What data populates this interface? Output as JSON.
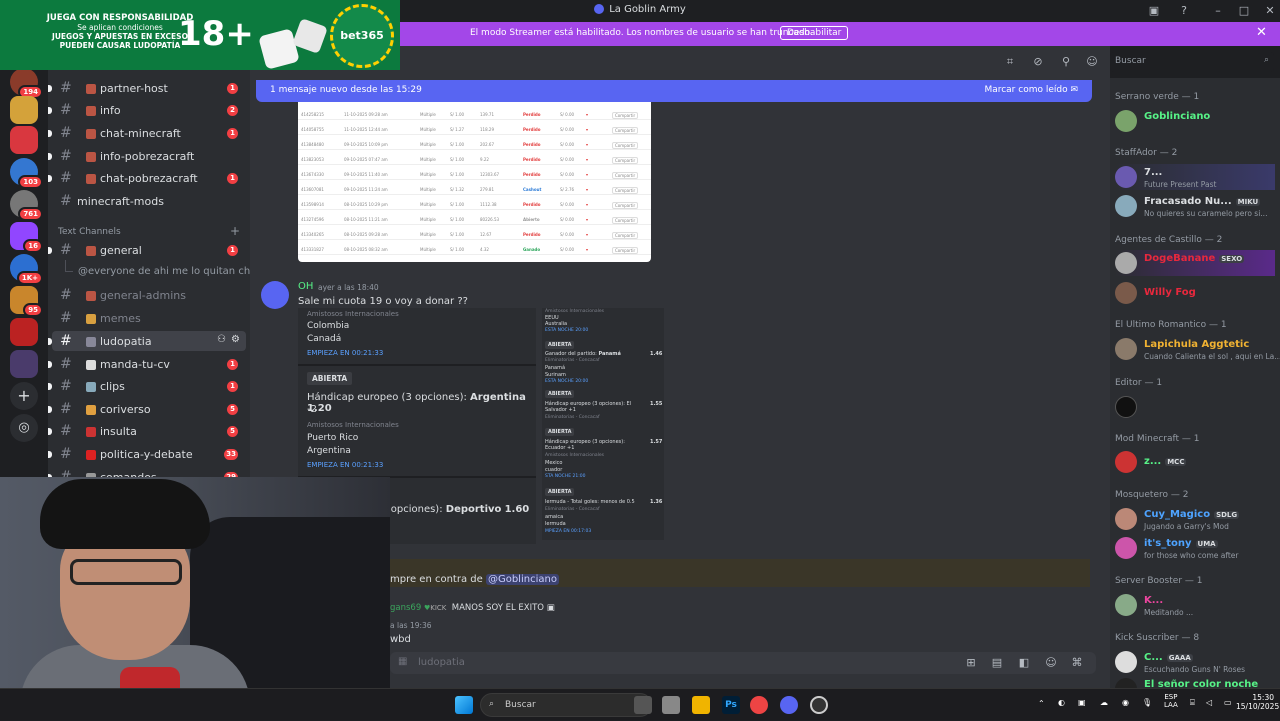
{
  "window": {
    "title": "La Goblin Army"
  },
  "ad": {
    "lines": [
      "JUEGA CON RESPONSABILIDAD",
      "Se aplican condiciones",
      "JUEGOS Y APUESTAS EN EXCESO",
      "PUEDEN CAUSAR LUDOPATÍA"
    ],
    "age": "18+",
    "brand": "bet365"
  },
  "streamer": {
    "text": "El modo Streamer está habilitado. Los nombres de usuario se han truncado.",
    "button": "Deshabilitar"
  },
  "search": {
    "placeholder": "Buscar"
  },
  "servers": [
    {
      "badge": "194"
    },
    {
      "badge": ""
    },
    {
      "badge": ""
    },
    {
      "badge": "103"
    },
    {
      "badge": "761"
    },
    {
      "badge": "16"
    },
    {
      "badge": "1K+"
    },
    {
      "badge": "95"
    },
    {
      "badge": ""
    },
    {
      "badge": ""
    }
  ],
  "channels": [
    {
      "name": "partner-host",
      "count": "1"
    },
    {
      "name": "info",
      "count": "2"
    },
    {
      "name": "chat-minecraft",
      "count": "1"
    },
    {
      "name": "info-pobrezacraft",
      "count": ""
    },
    {
      "name": "chat-pobrezacraft",
      "count": "1"
    },
    {
      "name": "minecraft-mods",
      "count": ""
    }
  ],
  "text_channels_label": "Text Channels",
  "text_channels": [
    {
      "name": "general",
      "count": "1"
    },
    {
      "name": "general-admins",
      "count": ""
    },
    {
      "name": "memes",
      "count": ""
    },
    {
      "name": "ludopatia",
      "count": ""
    },
    {
      "name": "manda-tu-cv",
      "count": "1"
    },
    {
      "name": "clips",
      "count": "1"
    },
    {
      "name": "coriverso",
      "count": "5"
    },
    {
      "name": "insulta",
      "count": "5"
    },
    {
      "name": "politica-y-debate",
      "count": "33"
    },
    {
      "name": "comandos",
      "count": "29"
    }
  ],
  "thread": "@everyone de ahi me lo quitan ch...",
  "new_messages": {
    "text": "1 mensaje nuevo desde las 15:29",
    "mark": "Marcar como leído"
  },
  "table_rows": [
    {
      "id": "414258215",
      "date": "11-10-2025 09:28 am",
      "type": "Múltiple",
      "stake": "S/ 1.00",
      "odds": "139.71",
      "status": "Perdido",
      "ret": "S/ 0.00"
    },
    {
      "id": "414058755",
      "date": "11-10-2025 12:44 am",
      "type": "Múltiple",
      "stake": "S/ 1.27",
      "odds": "118.29",
      "status": "Perdido",
      "ret": "S/ 0.00"
    },
    {
      "id": "413848480",
      "date": "09-10-2025 10:09 pm",
      "type": "Múltiple",
      "stake": "S/ 1.00",
      "odds": "202.67",
      "status": "Perdido",
      "ret": "S/ 0.00"
    },
    {
      "id": "413823053",
      "date": "09-10-2025 07:47 am",
      "type": "Múltiple",
      "stake": "S/ 1.00",
      "odds": "9.22",
      "status": "Perdido",
      "ret": "S/ 0.00"
    },
    {
      "id": "413674330",
      "date": "09-10-2025 11:40 am",
      "type": "Múltiple",
      "stake": "S/ 1.00",
      "odds": "12303.67",
      "status": "Perdido",
      "ret": "S/ 0.00"
    },
    {
      "id": "413607081",
      "date": "09-10-2025 11:24 am",
      "type": "Múltiple",
      "stake": "S/ 1.32",
      "odds": "279.81",
      "status": "Cashout",
      "ret": "S/ 2.76"
    },
    {
      "id": "413598914",
      "date": "08-10-2025 10:29 pm",
      "type": "Múltiple",
      "stake": "S/ 1.00",
      "odds": "1112.38",
      "status": "Perdido",
      "ret": "S/ 0.00"
    },
    {
      "id": "413274596",
      "date": "08-10-2025 11:21 am",
      "type": "Múltiple",
      "stake": "S/ 1.00",
      "odds": "80226.53",
      "status": "Abierto",
      "ret": "S/ 0.00"
    },
    {
      "id": "413340265",
      "date": "08-10-2025 09:28 am",
      "type": "Múltiple",
      "stake": "S/ 1.00",
      "odds": "12.67",
      "status": "Perdido",
      "ret": "S/ 0.00"
    },
    {
      "id": "413331827",
      "date": "08-10-2025 08:32 am",
      "type": "Múltiple",
      "stake": "S/ 1.00",
      "odds": "4.32",
      "status": "Ganado",
      "ret": "S/ 0.00"
    }
  ],
  "share_label": "Compartir",
  "message": {
    "author": "OH",
    "time": "ayer a las 18:40",
    "text": "Sale mi cuota 19  o voy a donar ??"
  },
  "bets_left": {
    "m1": {
      "league": "Amistosos Internacionales",
      "teams": [
        "Colombia",
        "Canadá"
      ],
      "start": "EMPIEZA EN 00:21:33"
    },
    "m2": {
      "badge": "ABIERTA",
      "market": "Hándicap europeo (3 opciones):",
      "pick": "Argentina",
      "odd": "1.20",
      "line": "-2",
      "league": "Amistosos Internacionales",
      "teams": [
        "Puerto Rico",
        "Argentina"
      ],
      "start": "EMPIEZA EN 00:21:33"
    },
    "m3": {
      "market": "o (3 opciones):",
      "pick": "Deportivo",
      "odd": "1.60"
    }
  },
  "bets_right": {
    "r1": {
      "league": "Amistosos Internacionales",
      "teams": [
        "EEUU",
        "Australia"
      ],
      "start": "ESTA NOCHE 20:00"
    },
    "r2": {
      "badge": "ABIERTA",
      "market": "Ganador del partido:",
      "pick": "Panamá",
      "odd": "1.46",
      "league": "Eliminatorias - Concacaf",
      "teams": [
        "Panamá",
        "Surinam"
      ],
      "start": "ESTA NOCHE 20:00"
    },
    "r3": {
      "badge": "ABIERTA",
      "market": "Hándicap europeo (3 opciones):  El Salvador +1",
      "odd": "1.55",
      "league": "Eliminatorias - Concacaf"
    },
    "r4": {
      "badge": "ABIERTA",
      "market": "Hándicap europeo (3 opciones): Ecuador +1",
      "odd": "1.57",
      "league": "Amistosos Internacionales",
      "teams": [
        "Mexico",
        "cuador"
      ],
      "start": "STA NOCHE 21:00"
    },
    "r5": {
      "badge": "ABIERTA",
      "market": "lermuda - Total goles:  menos de 0.5",
      "odd": "1.36",
      "league": "Eliminatorias - Concacaf",
      "teams": [
        "amaica",
        "lermuda"
      ],
      "start": "MPIEZA EN 00:17:03"
    }
  },
  "mention_msg": {
    "prefix": "mpre en contra de",
    "mention": "@Goblinciano"
  },
  "msg2": {
    "user": "gans69",
    "tag": "KICK",
    "text": "MANOS SOY EL EXITO"
  },
  "msg3": {
    "time": "a las 19:36",
    "text": "wbd"
  },
  "composer": {
    "placeholder": "ludopatia"
  },
  "members": [
    {
      "role": "Serrano verde — 1",
      "users": [
        {
          "name": "Goblinciano",
          "sub": "",
          "color": "#3ba55d",
          "tag": ""
        }
      ]
    },
    {
      "role": "StaffAdor — 2",
      "users": [
        {
          "name": "7...",
          "sub": "Future Present Past",
          "color": "#f2f3f5",
          "tag": ""
        },
        {
          "name": "Fracasado Nu...",
          "sub": "No quieres su caramelo pero si...",
          "color": "#f2f3f5",
          "tag": "MIKU"
        }
      ]
    },
    {
      "role": "Agentes de Castillo — 2",
      "users": [
        {
          "name": "DogeBanane",
          "sub": "",
          "color": "#e8283d",
          "tag": "SEXO"
        },
        {
          "name": "Willy Fog",
          "sub": "",
          "color": "#e8283d",
          "tag": ""
        }
      ]
    },
    {
      "role": "El Ultimo Romantico — 1",
      "users": [
        {
          "name": "Lapichula Aggtetic",
          "sub": "Cuando Calienta el sol , aqui en La...",
          "color": "#f0b232",
          "tag": ""
        }
      ]
    },
    {
      "role": "Editor — 1",
      "users": [
        {
          "name": "",
          "sub": "",
          "color": "#f2f3f5",
          "tag": ""
        }
      ]
    },
    {
      "role": "Mod Minecraft — 1",
      "users": [
        {
          "name": "z...",
          "sub": "",
          "color": "#57f287",
          "tag": "MCC"
        }
      ]
    },
    {
      "role": "Mosquetero — 2",
      "users": [
        {
          "name": "Cuy_Magico",
          "sub": "Jugando a Garry's Mod",
          "color": "#4ea3ff",
          "tag": "SDLG"
        },
        {
          "name": "it's_tony",
          "sub": "for those who come after",
          "color": "#4ea3ff",
          "tag": "UMA"
        }
      ]
    },
    {
      "role": "Server Booster — 1",
      "users": [
        {
          "name": "K...",
          "sub": "Meditando ...",
          "color": "#eb459e",
          "tag": ""
        }
      ]
    },
    {
      "role": "Kick Suscriber — 8",
      "users": [
        {
          "name": "C...",
          "sub": "Escuchando Guns N' Roses",
          "color": "#57f287",
          "tag": "GAAA"
        },
        {
          "name": "El señor color noche",
          "sub": "",
          "color": "#57f287",
          "tag": ""
        }
      ]
    }
  ],
  "taskbar": {
    "search": "Buscar",
    "lang": "ESP",
    "layout": "LAA",
    "time": "15:30",
    "date": "15/10/2025"
  }
}
